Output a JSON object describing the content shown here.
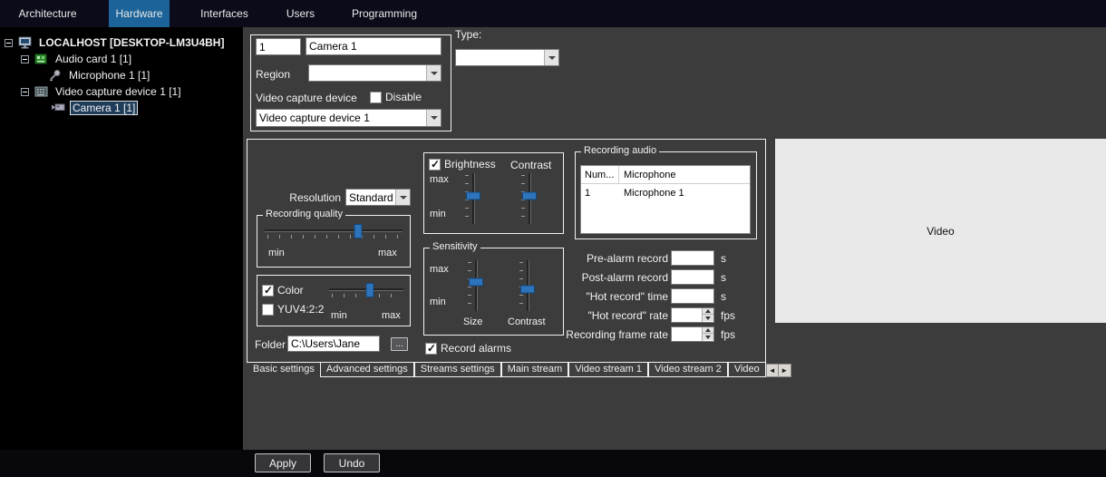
{
  "colors": {
    "menu_active": "#1b6399",
    "slider_thumb": "#2d74bd",
    "video_bg": "#e9e9e9",
    "panel_bg": "#3c3c3c"
  },
  "menu": {
    "items": [
      {
        "label": "Architecture"
      },
      {
        "label": "Hardware"
      },
      {
        "label": "Interfaces"
      },
      {
        "label": "Users"
      },
      {
        "label": "Programming"
      }
    ]
  },
  "tree": {
    "items": [
      {
        "label": "LOCALHOST [DESKTOP-LM3U4BH]",
        "icon": "computer-icon"
      },
      {
        "label": "Audio card 1 [1]",
        "icon": "audio-card-icon"
      },
      {
        "label": "Microphone 1 [1]",
        "icon": "microphone-icon"
      },
      {
        "label": "Video capture device 1 [1]",
        "icon": "video-capture-icon"
      },
      {
        "label": "Camera 1 [1]",
        "icon": "camera-icon",
        "selected": true
      }
    ]
  },
  "device": {
    "number": "1",
    "name": "Camera 1",
    "region_label": "Region",
    "region_value": "",
    "capture_label": "Video capture device",
    "disable_label": "Disable",
    "disable_checked": false,
    "capture_value": "Video capture device 1",
    "type_label": "Type:",
    "type_value": ""
  },
  "settings": {
    "resolution_label": "Resolution",
    "resolution_value": "Standard",
    "recording_quality": {
      "title": "Recording quality",
      "min_label": "min",
      "max_label": "max",
      "value_pct": 68
    },
    "color_group": {
      "color_label": "Color",
      "color_checked": true,
      "yuv_label": "YUV4:2:2",
      "yuv_checked": false,
      "min_label": "min",
      "max_label": "max",
      "value_pct": 55
    },
    "folder_label": "Folder",
    "folder_value": "C:\\Users\\Jane",
    "browse_label": "...",
    "brightness_group": {
      "brightness_label": "Brightness",
      "brightness_checked": true,
      "contrast_label": "Contrast",
      "max_label": "max",
      "min_label": "min",
      "brightness_pct": 45,
      "contrast_pct": 45
    },
    "sensitivity_group": {
      "title": "Sensitivity",
      "max_label": "max",
      "min_label": "min",
      "size_label": "Size",
      "contrast_label": "Contrast",
      "size_pct": 42,
      "contrast_pct": 58
    },
    "record_alarms_label": "Record alarms",
    "record_alarms_checked": true,
    "recording_audio": {
      "title": "Recording audio",
      "columns": [
        "Num...",
        "Microphone"
      ],
      "rows": [
        [
          "1",
          "Microphone 1"
        ]
      ]
    },
    "fields": [
      {
        "label": "Pre-alarm record",
        "value": "",
        "unit": "s"
      },
      {
        "label": "Post-alarm record",
        "value": "",
        "unit": "s"
      },
      {
        "label": "\"Hot record\" time",
        "value": "",
        "unit": "s"
      },
      {
        "label": "\"Hot record\" rate",
        "value": "",
        "unit": "fps"
      },
      {
        "label": "Recording frame rate",
        "value": "",
        "unit": "fps"
      }
    ],
    "tabs": [
      {
        "label": "Basic settings",
        "active": true
      },
      {
        "label": "Advanced settings"
      },
      {
        "label": "Streams settings"
      },
      {
        "label": "Main stream"
      },
      {
        "label": "Video stream 1"
      },
      {
        "label": "Video stream 2"
      },
      {
        "label": "Video"
      }
    ],
    "tab_scroll_left": "◄",
    "tab_scroll_right": "►"
  },
  "video_panel": {
    "label": "Video"
  },
  "footer": {
    "apply_label": "Apply",
    "undo_label": "Undo"
  }
}
